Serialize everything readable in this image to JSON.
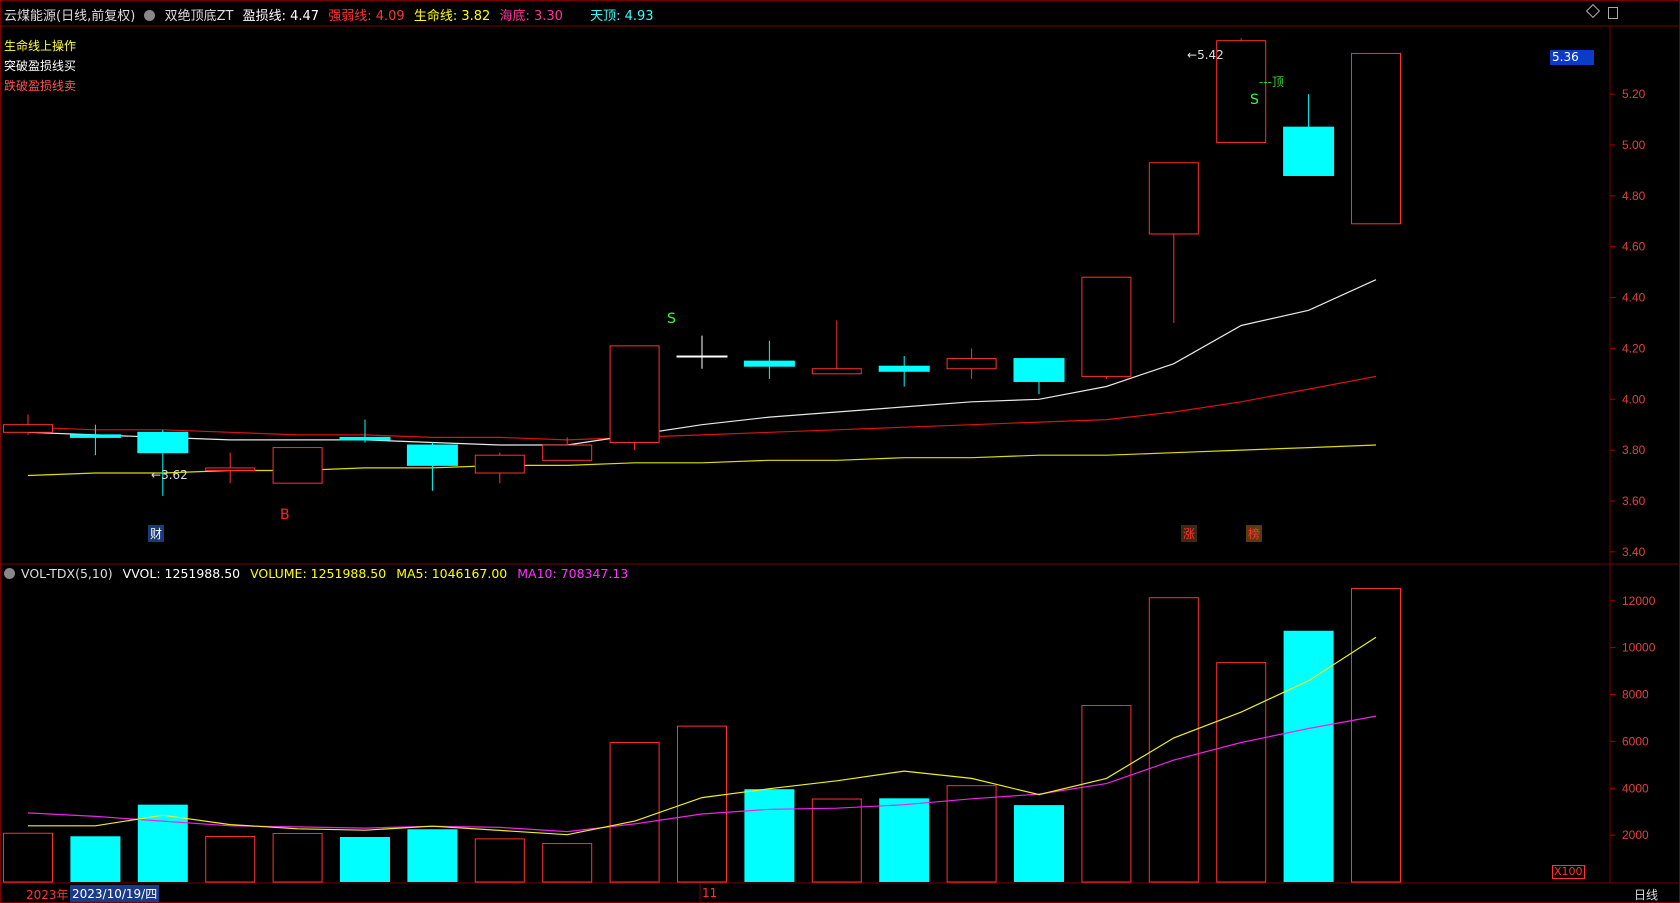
{
  "header": {
    "stock": "云煤能源(日线,前复权)",
    "indicator": "双绝顶底ZT",
    "items": [
      {
        "label": "盈损线:",
        "value": "4.47",
        "color": "#ffffff"
      },
      {
        "label": "强弱线:",
        "value": "4.09",
        "color": "#ff3333"
      },
      {
        "label": "生命线:",
        "value": "3.82",
        "color": "#ffff00"
      },
      {
        "label": "海底:",
        "value": "3.30",
        "color": "#ff3399"
      },
      {
        "label": "天顶:",
        "value": "4.93",
        "color": "#33ffff"
      }
    ]
  },
  "legend": [
    {
      "text": "生命线上操作",
      "color": "#ffff33"
    },
    {
      "text": "突破盈损线买",
      "color": "#ffffff"
    },
    {
      "text": "跌破盈损线卖",
      "color": "#ff5555"
    }
  ],
  "volume_header": {
    "name": "VOL-TDX(5,10)",
    "items": [
      {
        "label": "VVOL:",
        "value": "1251988.50",
        "color": "#ffffff"
      },
      {
        "label": "VOLUME:",
        "value": "1251988.50",
        "color": "#ffff00"
      },
      {
        "label": "MA5:",
        "value": "1046167.00",
        "color": "#ffff00"
      },
      {
        "label": "MA10:",
        "value": "708347.13",
        "color": "#ff33ff"
      }
    ]
  },
  "price_axis": {
    "ticks": [
      "5.20",
      "5.00",
      "4.80",
      "4.60",
      "4.40",
      "4.20",
      "4.00",
      "3.80",
      "3.60",
      "3.40"
    ],
    "current": "5.36"
  },
  "volume_axis": {
    "ticks": [
      "12000",
      "10000",
      "8000",
      "6000",
      "4000",
      "2000"
    ],
    "unit": "X100"
  },
  "date_bar": {
    "year": "2023年",
    "date": "2023/10/19/四",
    "month": "11",
    "period": "日线"
  },
  "annotations": {
    "high": "5.42",
    "low": "3.62",
    "top_label": "---顶",
    "sell_mark": "S",
    "buy_mark": "B",
    "cai": "财",
    "zhang": "涨",
    "bang": "榜"
  },
  "icons": [
    "diamond-icon",
    "window-icon",
    "menu-dot-icon"
  ],
  "chart_data": {
    "type": "candlestick",
    "price_ylim": [
      3.36,
      5.46
    ],
    "candles": [
      {
        "o": 3.87,
        "c": 3.9,
        "h": 3.94,
        "l": 3.86
      },
      {
        "o": 3.86,
        "c": 3.85,
        "h": 3.9,
        "l": 3.78
      },
      {
        "o": 3.87,
        "c": 3.79,
        "h": 3.88,
        "l": 3.62
      },
      {
        "o": 3.72,
        "c": 3.73,
        "h": 3.79,
        "l": 3.67
      },
      {
        "o": 3.67,
        "c": 3.81,
        "h": 3.81,
        "l": 3.67
      },
      {
        "o": 3.85,
        "c": 3.84,
        "h": 3.92,
        "l": 3.83
      },
      {
        "o": 3.82,
        "c": 3.74,
        "h": 3.83,
        "l": 3.64
      },
      {
        "o": 3.71,
        "c": 3.78,
        "h": 3.79,
        "l": 3.67
      },
      {
        "o": 3.76,
        "c": 3.82,
        "h": 3.85,
        "l": 3.76
      },
      {
        "o": 3.83,
        "c": 4.21,
        "h": 4.21,
        "l": 3.8
      },
      {
        "o": 4.17,
        "c": 4.17,
        "h": 4.25,
        "l": 4.12
      },
      {
        "o": 4.15,
        "c": 4.13,
        "h": 4.23,
        "l": 4.08
      },
      {
        "o": 4.1,
        "c": 4.12,
        "h": 4.31,
        "l": 4.1
      },
      {
        "o": 4.13,
        "c": 4.11,
        "h": 4.17,
        "l": 4.05
      },
      {
        "o": 4.12,
        "c": 4.16,
        "h": 4.2,
        "l": 4.08
      },
      {
        "o": 4.16,
        "c": 4.07,
        "h": 4.16,
        "l": 4.02
      },
      {
        "o": 4.09,
        "c": 4.48,
        "h": 4.48,
        "l": 4.08
      },
      {
        "o": 4.65,
        "c": 4.93,
        "h": 4.93,
        "l": 4.3
      },
      {
        "o": 5.01,
        "c": 5.41,
        "h": 5.42,
        "l": 5.01
      },
      {
        "o": 5.07,
        "c": 4.88,
        "h": 5.2,
        "l": 4.88
      },
      {
        "o": 4.69,
        "c": 5.36,
        "h": 5.36,
        "l": 4.69
      }
    ],
    "ma_white": [
      3.87,
      3.86,
      3.85,
      3.84,
      3.84,
      3.84,
      3.83,
      3.82,
      3.82,
      3.86,
      3.9,
      3.93,
      3.95,
      3.97,
      3.99,
      4.0,
      4.05,
      4.14,
      4.29,
      4.35,
      4.47
    ],
    "ma_red": [
      3.89,
      3.88,
      3.88,
      3.87,
      3.86,
      3.86,
      3.85,
      3.85,
      3.84,
      3.85,
      3.86,
      3.87,
      3.88,
      3.89,
      3.9,
      3.91,
      3.92,
      3.95,
      3.99,
      4.04,
      4.09
    ],
    "ma_yellow": [
      3.7,
      3.71,
      3.71,
      3.72,
      3.72,
      3.73,
      3.73,
      3.74,
      3.74,
      3.75,
      3.75,
      3.76,
      3.76,
      3.77,
      3.77,
      3.78,
      3.78,
      3.79,
      3.8,
      3.81,
      3.82
    ],
    "volume_ylim": [
      0,
      12800
    ],
    "volumes": [
      2080,
      1950,
      3300,
      1940,
      2070,
      1920,
      2250,
      1840,
      1640,
      5950,
      6650,
      3960,
      3540,
      3570,
      4110,
      3280,
      7530,
      12130,
      9360,
      10720,
      12520
    ],
    "vol_ma5": [
      2400,
      2400,
      2850,
      2450,
      2270,
      2210,
      2380,
      2200,
      2020,
      2600,
      3600,
      3980,
      4320,
      4730,
      4420,
      3730,
      4420,
      6150,
      7250,
      8590,
      10440
    ],
    "vol_ma10": [
      2950,
      2800,
      2600,
      2400,
      2350,
      2300,
      2380,
      2330,
      2150,
      2480,
      2900,
      3100,
      3150,
      3300,
      3550,
      3750,
      4200,
      5200,
      5950,
      6550,
      7080
    ]
  }
}
